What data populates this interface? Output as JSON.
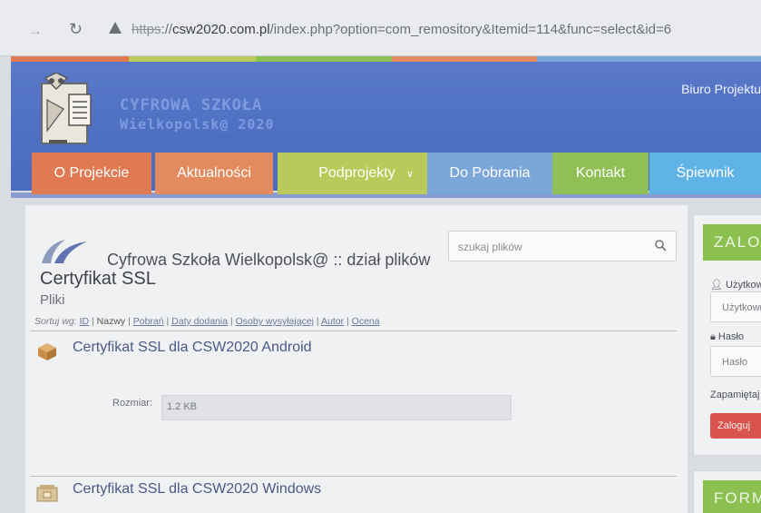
{
  "browser": {
    "url_scheme": "https",
    "url_sep": "://",
    "url_host": "csw2020.com.pl",
    "url_path": "/index.php?option=com_remository&Itemid=114&func=select&id=6"
  },
  "header": {
    "logo_title": "CYFROWA SZKOŁA",
    "logo_subtitle": "Wielkopolsk@ 2020",
    "top_link": "Biuro Projektu"
  },
  "nav": {
    "tabs": [
      {
        "label": "O Projekcie",
        "color": "#e07a52"
      },
      {
        "label": "Aktualności",
        "color": "#e38a5f"
      },
      {
        "label": "Podprojekty",
        "color": "#b9c95a"
      },
      {
        "label": "Do Pobrania",
        "color": "#7ba7d8"
      },
      {
        "label": "Kontakt",
        "color": "#8fbf55"
      },
      {
        "label": "Śpiewnik",
        "color": "#5fb3e6"
      }
    ]
  },
  "content": {
    "search_placeholder": "szukaj plików",
    "repo_title": "Cyfrowa Szkoła Wielkopolsk@ :: dział plików",
    "heading": "Certyfikat SSL",
    "subheading": "Pliki",
    "sort": {
      "label": "Sortuj wg:",
      "links": [
        "ID",
        "Nazwy",
        "Pobrań",
        "Daty dodania",
        "Osoby wysyłającej",
        "Autor",
        "Ocena"
      ]
    },
    "files": [
      {
        "name": "Certyfikat SSL dla CSW2020 Android",
        "size_label": "Rozmiar:",
        "size": "1.2 KB"
      },
      {
        "name": "Certyfikat SSL dla CSW2020 Windows"
      }
    ]
  },
  "sidebar": {
    "login_title": "ZALOGUJ",
    "user_label": "Użytkownik",
    "user_placeholder": "Użytkownik",
    "password_label": "Hasło",
    "password_placeholder": "Hasło",
    "remember_label": "Zapamiętaj",
    "login_button": "Zaloguj",
    "form_title": "FORMULARZ"
  }
}
